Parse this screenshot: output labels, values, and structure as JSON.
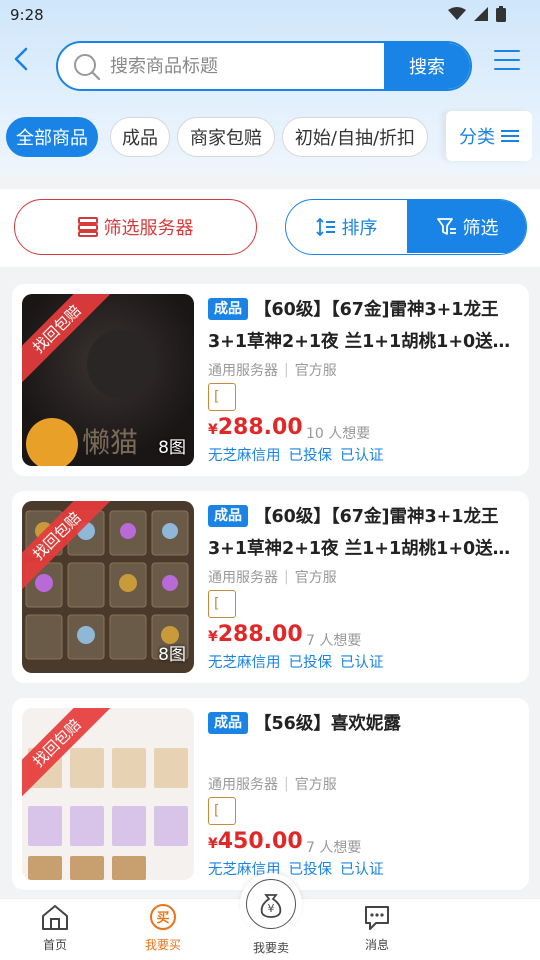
{
  "status": {
    "time": "9:28"
  },
  "search": {
    "placeholder": "搜索商品标题",
    "button": "搜索"
  },
  "chips": [
    "全部商品",
    "成品",
    "商家包赔",
    "初始/自抽/折扣"
  ],
  "category_label": "分类",
  "filters": {
    "server_label": "筛选服务器",
    "sort_label": "排序",
    "filter_label": "筛选"
  },
  "listings": [
    {
      "ribbon": "找回包赔",
      "image_count": "8图",
      "image_watermark": "懒猫",
      "tag": "成品",
      "title": "【60级】【67金]雷神3+1龙王3+1草神2+1夜 兰1+1胡桃1+0送…",
      "server": "通用服务器",
      "channel": "官方服",
      "bracket": "[",
      "currency": "¥",
      "price": "288.00",
      "wants": "10 人想要",
      "badges": [
        "无芝麻信用",
        "已投保",
        "已认证"
      ]
    },
    {
      "ribbon": "找回包赔",
      "image_count": "8图",
      "tag": "成品",
      "title": "【60级】【67金]雷神3+1龙王3+1草神2+1夜 兰1+1胡桃1+0送…",
      "server": "通用服务器",
      "channel": "官方服",
      "bracket": "[",
      "currency": "¥",
      "price": "288.00",
      "wants": "7 人想要",
      "badges": [
        "无芝麻信用",
        "已投保",
        "已认证"
      ]
    },
    {
      "ribbon": "找回包赔",
      "tag": "成品",
      "title": "【56级】喜欢妮露",
      "server": "通用服务器",
      "channel": "官方服",
      "bracket": "[",
      "currency": "¥",
      "price": "450.00",
      "wants": "7 人想要",
      "badges": [
        "无芝麻信用",
        "已投保",
        "已认证"
      ]
    }
  ],
  "tabs": [
    {
      "label": "首页",
      "icon": "home-icon"
    },
    {
      "label": "我要买",
      "icon": "buy-icon",
      "icon_text": "买"
    },
    {
      "label": "我要卖",
      "icon": "sell-icon",
      "icon_text": "¥"
    },
    {
      "label": "消息",
      "icon": "message-icon"
    }
  ],
  "colors": {
    "primary": "#1a84e6",
    "danger": "#e02828",
    "active_tab": "#e8731a"
  }
}
